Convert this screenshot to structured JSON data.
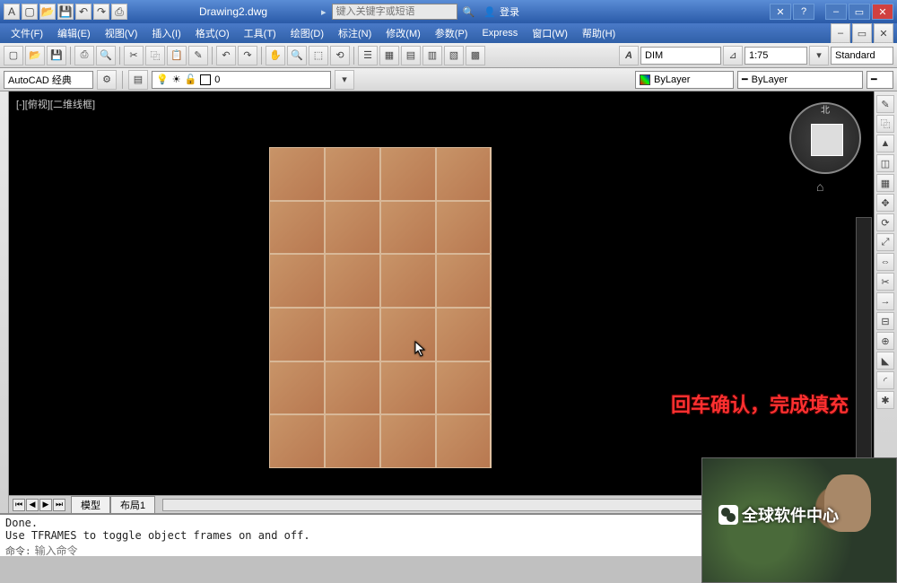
{
  "titlebar": {
    "doc_title": "Drawing2.dwg",
    "search_placeholder": "键入关键字或短语",
    "login_label": "登录"
  },
  "menu": {
    "items": [
      "文件(F)",
      "编辑(E)",
      "视图(V)",
      "插入(I)",
      "格式(O)",
      "工具(T)",
      "绘图(D)",
      "标注(N)",
      "修改(M)",
      "参数(P)",
      "Express",
      "窗口(W)",
      "帮助(H)"
    ]
  },
  "toolbar2": {
    "style_combo": "DIM",
    "scale_combo": "1:75",
    "std_combo": "Standard"
  },
  "props": {
    "workspace": "AutoCAD 经典",
    "layer_name": "0",
    "color": "ByLayer",
    "linetype": "ByLayer"
  },
  "viewport": {
    "label": "[-][俯视][二维线框]"
  },
  "viewcube": {
    "north": "北"
  },
  "annotation": {
    "text": "回车确认，完成填充"
  },
  "tabs": {
    "model": "模型",
    "layout1": "布局1"
  },
  "command": {
    "line1": "Done.",
    "line2": "Use TFRAMES to toggle object frames on and off.",
    "prompt": "命令:",
    "hint": "输入命令"
  },
  "watermark": {
    "label": "全球软件中心"
  }
}
